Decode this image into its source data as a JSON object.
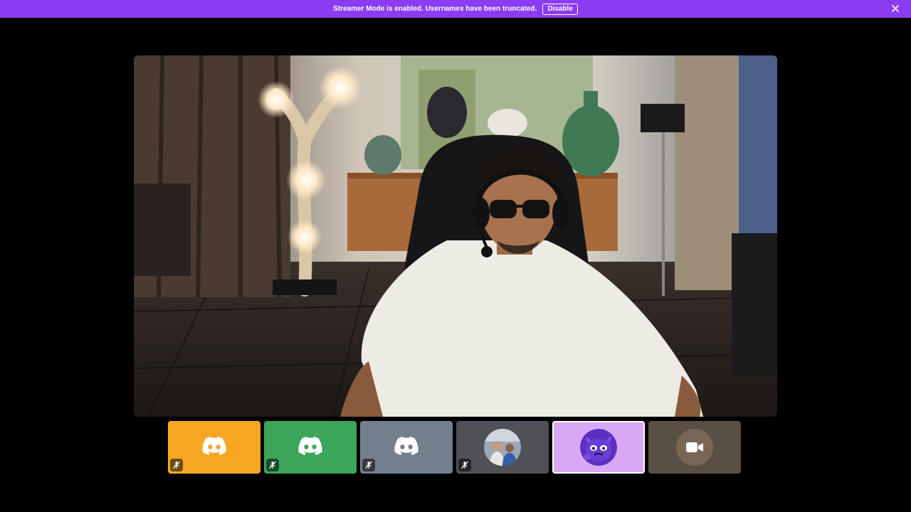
{
  "banner": {
    "message": "Streamer Mode is enabled. Usernames have been truncated.",
    "disable_label": "Disable",
    "close_icon": "close-icon",
    "color": "#8c3cf0"
  },
  "stage": {
    "content": "camera-video-feed"
  },
  "tiles": [
    {
      "kind": "discord-logo",
      "bg": "#f5a623",
      "muted": true,
      "selected": false
    },
    {
      "kind": "discord-logo",
      "bg": "#3ba55c",
      "muted": true,
      "selected": false
    },
    {
      "kind": "discord-logo",
      "bg": "#747f8d",
      "muted": true,
      "selected": false
    },
    {
      "kind": "photo-avatar",
      "bg": "#4f5157",
      "muted": true,
      "selected": false
    },
    {
      "kind": "creature-avatar",
      "bg": "#d9a8f5",
      "muted": false,
      "selected": true
    },
    {
      "kind": "camera-placeholder",
      "bg": "#5a4f45",
      "muted": false,
      "selected": false
    }
  ]
}
